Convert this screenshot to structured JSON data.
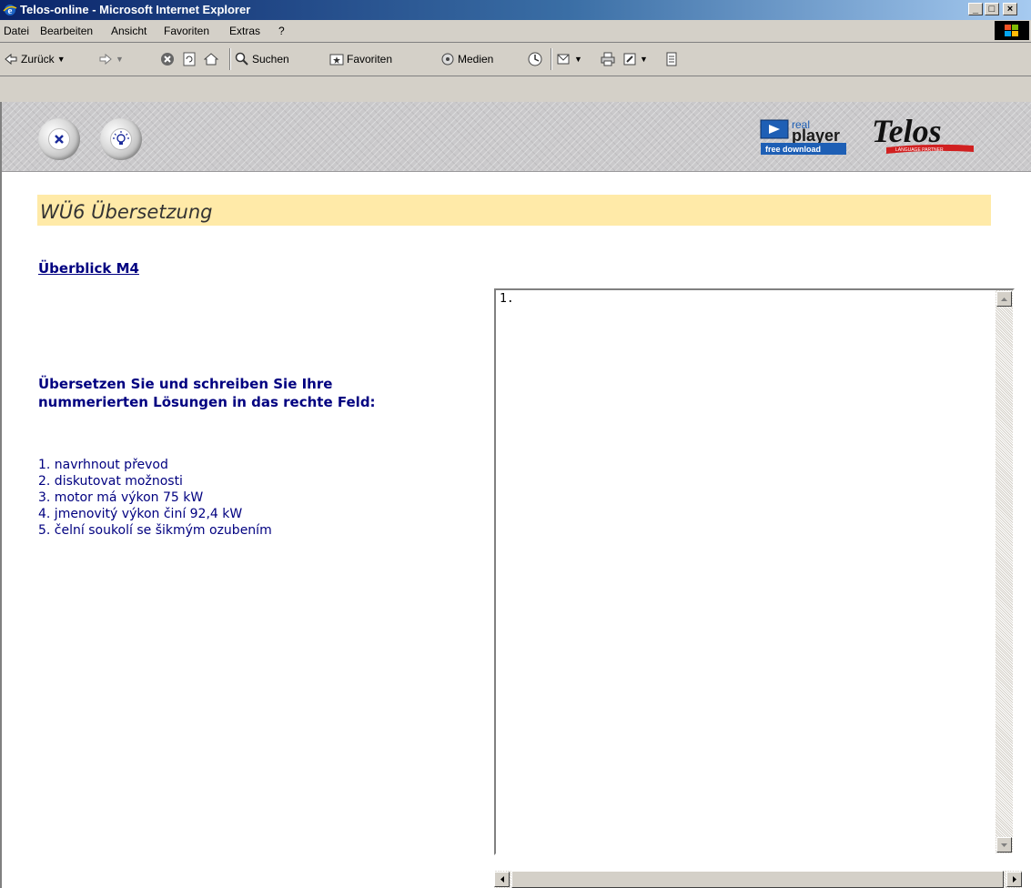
{
  "window": {
    "title": "Telos-online - Microsoft Internet Explorer",
    "controls": {
      "minimize": "_",
      "maximize": "□",
      "close": "×"
    }
  },
  "menu": [
    "Datei",
    "Bearbeiten",
    "Ansicht",
    "Favoriten",
    "Extras",
    "?"
  ],
  "toolbar": {
    "back_label": "Zurück",
    "search_label": "Suchen",
    "favorites_label": "Favoriten",
    "media_label": "Medien"
  },
  "banner": {
    "realplayer": {
      "line1": "real",
      "line2": "player",
      "line3": "free download"
    },
    "telos_logo": "Telos",
    "telos_tagline": "LANGUAGE PARTNER"
  },
  "page": {
    "title": "WÜ6 Übersetzung",
    "overview_link": "Überblick M4",
    "instruction_line1": "Übersetzen Sie und schreiben Sie Ihre",
    "instruction_line2": "nummerierten Lösungen in das rechte Feld:",
    "phrases": [
      "1. navrhnout převod",
      "2. diskutovat možnosti",
      "3. motor má výkon 75 kW",
      "4. jmenovitý výkon činí 92,4 kW",
      "5. čelní soukolí se šikmým ozubením"
    ],
    "answer_text": "1."
  },
  "colors": {
    "accent": "#000080",
    "heading_band": "#ffeaa8",
    "titlebar": "#0a246a"
  }
}
